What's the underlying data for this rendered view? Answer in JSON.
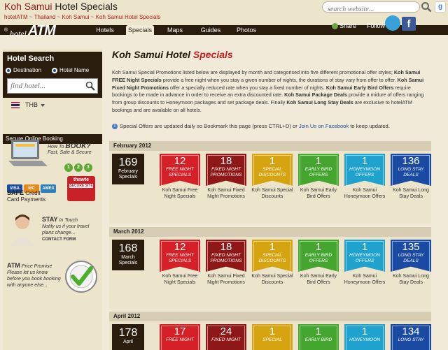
{
  "header": {
    "title_a": "Koh Samui",
    "title_b": " Hotel Specials",
    "breadcrumb": [
      "hotelATM",
      "Thailand",
      "Koh Samui",
      "Koh Samui Hotel Specials"
    ],
    "breadcrumb_sep": " ~ ",
    "search_placeholder": "search website...",
    "google_icon_label": "g"
  },
  "nav": {
    "logo_hotel": "hotel",
    "logo_atm": "ATM",
    "logo_reg": "®",
    "items": [
      "Hotels",
      "Specials",
      "Maps",
      "Guides",
      "Photos"
    ],
    "active": "Specials",
    "share_label": "Share",
    "follow_label": "Follow",
    "fb_letter": "f"
  },
  "sidebar": {
    "hotel_search_title": "Hotel Search",
    "radio_destination": "Destination",
    "radio_hotel_name": "Hotel Name",
    "find_placeholder": "find hotel...",
    "currency": "THB",
    "secure_booking": "Secure Online Booking",
    "how_to": "How To ",
    "book": "BOOK?",
    "fast_safe": "Fast, Safe & Secure",
    "steps": [
      "1",
      "2",
      "3"
    ],
    "cards": [
      "VISA",
      "MC",
      "AMEX"
    ],
    "safe": "SAFE",
    "credit": " Credit",
    "card_payments": "Card Payments",
    "thawte": "thawte",
    "secure_site": "SECURE SITE",
    "stay": "STAY",
    "in_touch": " In Touch",
    "stay_body": "Notify us if your travel plans change...",
    "contact_form": "CONTACT FORM",
    "atm": "ATM",
    "price_promise": " Price Promise",
    "atm_body": "Please let us know before you book booking with anyone else..."
  },
  "main": {
    "title_a": "Koh Samui Hotel ",
    "title_b": "Specials",
    "intro": [
      {
        "t": "Koh Samui Special Promotions listed below are displayed by month and categorised into five different promotional offer styles; ",
        "b": false
      },
      {
        "t": "Koh Samui FREE Night Specials",
        "b": true
      },
      {
        "t": " provide a free night when you stay a given number of nights, the durations of stay vary from offer to offer. ",
        "b": false
      },
      {
        "t": "Koh Samui Fixed Night Promotions",
        "b": true
      },
      {
        "t": " offer a specially reduced rate when you stay a fixed number of nights. ",
        "b": false
      },
      {
        "t": "Koh Samui Early Bird Offers",
        "b": true
      },
      {
        "t": " require bookings to be made in advance in order to receive an extra discounted rate. ",
        "b": false
      },
      {
        "t": "Koh Samui Package Deals",
        "b": true
      },
      {
        "t": " provide a midure of offers ranging from group discounts to Honeymoon packages and set package deals. Finally ",
        "b": false
      },
      {
        "t": "Koh Samui Long Stay Deals",
        "b": true
      },
      {
        "t": " are exclusive to hotelATM bookings and are available on all hotels.",
        "b": false
      }
    ],
    "update_text": "Special Offers are updated daily so Bookmark this page (press CTRL+D) or ",
    "update_link": "Join Us on Facebook",
    "update_tail": " to keep updated.",
    "months": [
      {
        "name": "February 2012",
        "total": "169",
        "total_label": "February Specials",
        "offers": [
          {
            "num": "12",
            "label": "FREE NIGHT SPECIALS",
            "caption": "Koh Samui Free Night Specials",
            "color": "#d52027"
          },
          {
            "num": "18",
            "label": "FIXED NIGHT PROMOTIONS",
            "caption": "Koh Samui Fixed Night Promotions",
            "color": "#8e1717"
          },
          {
            "num": "1",
            "label": "SPECIAL DISCOUNTS",
            "caption": "Koh Samui Special Discounts",
            "color": "#d7a411"
          },
          {
            "num": "1",
            "label": "EARLY BIRD OFFERS",
            "caption": "Koh Samui Early Bird Offers",
            "color": "#45a62f"
          },
          {
            "num": "1",
            "label": "HONEYMOON OFFERS",
            "caption": "Koh Samui Honeymoon Offers",
            "color": "#1fa2cd"
          },
          {
            "num": "136",
            "label": "LONG STAY DEALS",
            "caption": "Koh Samui Long Stay Deals",
            "color": "#1a4aa2"
          }
        ]
      },
      {
        "name": "March 2012",
        "total": "168",
        "total_label": "March Specials",
        "offers": [
          {
            "num": "12",
            "label": "FREE NIGHT SPECIALS",
            "caption": "Koh Samui Free Night Specials",
            "color": "#d52027"
          },
          {
            "num": "18",
            "label": "FIXED NIGHT PROMOTIONS",
            "caption": "Koh Samui Fixed Night Promotions",
            "color": "#8e1717"
          },
          {
            "num": "1",
            "label": "SPECIAL DISCOUNTS",
            "caption": "Koh Samui Special Discounts",
            "color": "#d7a411"
          },
          {
            "num": "1",
            "label": "EARLY BIRD OFFERS",
            "caption": "Koh Samui Early Bird Offers",
            "color": "#45a62f"
          },
          {
            "num": "1",
            "label": "HONEYMOON OFFERS",
            "caption": "Koh Samui Honeymoon Offers",
            "color": "#1fa2cd"
          },
          {
            "num": "135",
            "label": "LONG STAY DEALS",
            "caption": "Koh Samui Long Stay Deals",
            "color": "#1a4aa2"
          }
        ]
      },
      {
        "name": "April 2012",
        "total": "178",
        "total_label": "April",
        "offers": [
          {
            "num": "17",
            "label": "FREE NIGHT",
            "caption": "",
            "color": "#d52027"
          },
          {
            "num": "24",
            "label": "FIXED NIGHT",
            "caption": "",
            "color": "#8e1717"
          },
          {
            "num": "1",
            "label": "SPECIAL",
            "caption": "",
            "color": "#d7a411"
          },
          {
            "num": "1",
            "label": "EARLY BIRD",
            "caption": "",
            "color": "#45a62f"
          },
          {
            "num": "1",
            "label": "HONEYMOON",
            "caption": "",
            "color": "#1fa2cd"
          },
          {
            "num": "134",
            "label": "LONG STAY",
            "caption": "",
            "color": "#1a4aa2"
          }
        ]
      }
    ]
  }
}
